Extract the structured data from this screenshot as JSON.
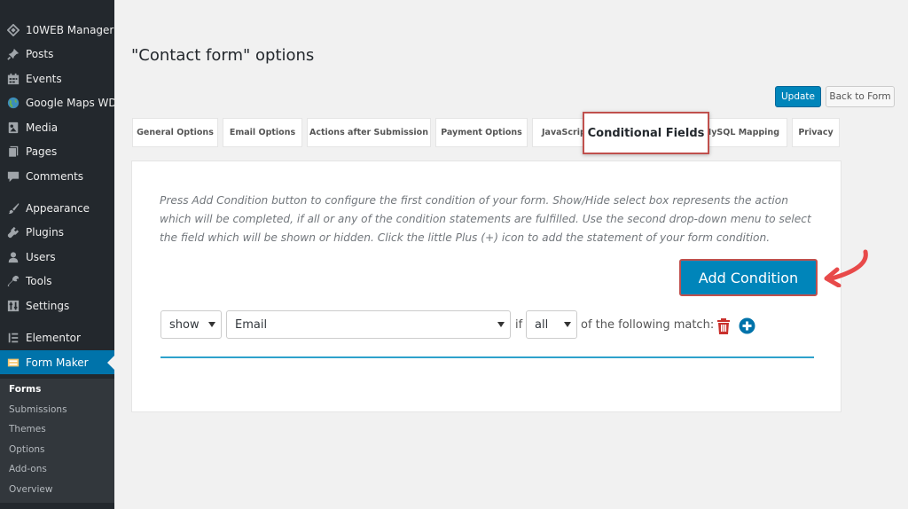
{
  "sidebar": {
    "items": [
      {
        "label": "10WEB Manager",
        "icon": "diamond-icon"
      },
      {
        "label": "Posts",
        "icon": "pin-icon"
      },
      {
        "label": "Events",
        "icon": "calendar-icon"
      },
      {
        "label": "Google Maps WD",
        "icon": "globe-icon"
      },
      {
        "label": "Media",
        "icon": "media-icon"
      },
      {
        "label": "Pages",
        "icon": "pages-icon"
      },
      {
        "label": "Comments",
        "icon": "comment-icon"
      },
      {
        "label": "Appearance",
        "icon": "brush-icon"
      },
      {
        "label": "Plugins",
        "icon": "plug-icon"
      },
      {
        "label": "Users",
        "icon": "user-icon"
      },
      {
        "label": "Tools",
        "icon": "wrench-icon"
      },
      {
        "label": "Settings",
        "icon": "settings-icon"
      },
      {
        "label": "Elementor",
        "icon": "elementor-icon"
      },
      {
        "label": "Form Maker",
        "icon": "form-icon",
        "active": true
      }
    ],
    "submenu": [
      {
        "label": "Forms",
        "current": true
      },
      {
        "label": "Submissions"
      },
      {
        "label": "Themes"
      },
      {
        "label": "Options"
      },
      {
        "label": "Add-ons"
      },
      {
        "label": "Overview"
      }
    ]
  },
  "page": {
    "title": "\"Contact form\" options",
    "update_label": "Update",
    "back_label": "Back to Form"
  },
  "tabs": [
    {
      "label": "General Options"
    },
    {
      "label": "Email Options"
    },
    {
      "label": "Actions after Submission"
    },
    {
      "label": "Payment Options"
    },
    {
      "label": "JavaScript"
    },
    {
      "label": "Conditional Fields",
      "active": true
    },
    {
      "label": "MySQL Mapping"
    },
    {
      "label": "Privacy"
    }
  ],
  "panel": {
    "help_text": "Press Add Condition button to configure the first condition of your form. Show/Hide select box represents the action which will be completed, if all or any of the condition statements are fulfilled. Use the second drop-down menu to select the field which will be shown or hidden. Click the little Plus (+) icon to add the statement of your form condition.",
    "add_condition_label": "Add Condition",
    "condition": {
      "action_value": "show",
      "field_value": "Email",
      "if_label": "if",
      "match_value": "all",
      "suffix_label": "of the following match:"
    }
  },
  "colors": {
    "sidebar_bg": "#23282d",
    "accent": "#0085ba",
    "highlight_border": "#c0504d",
    "delete_icon": "#c9302c",
    "add_icon": "#0073aa"
  }
}
